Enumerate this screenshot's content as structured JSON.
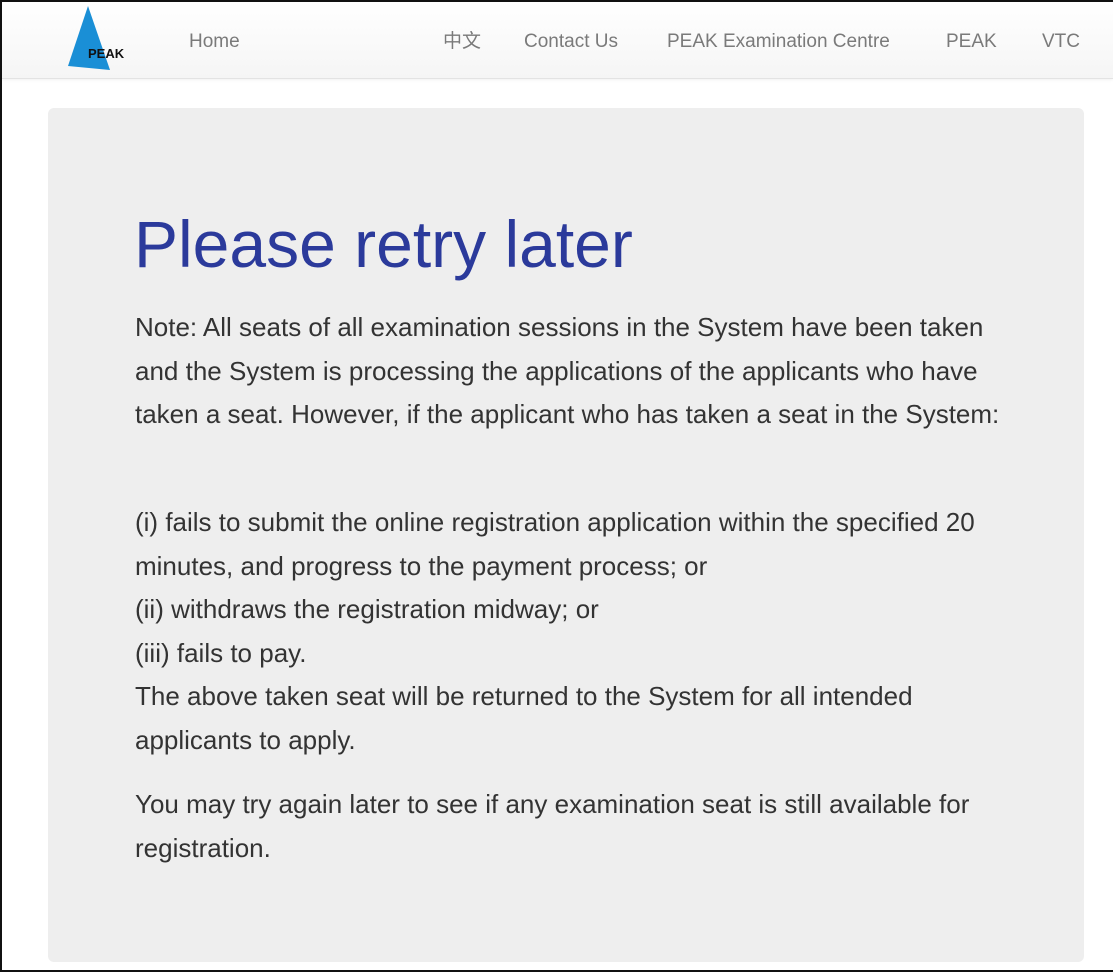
{
  "brand": {
    "logo_text": "PEAK",
    "logo_color": "#1a8fd6"
  },
  "nav": {
    "home": "Home",
    "chinese": "中文",
    "contact": "Contact Us",
    "exam_centre": "PEAK Examination Centre",
    "peak": "PEAK",
    "vtc": "VTC"
  },
  "main": {
    "title": "Please retry later",
    "note": "Note: All seats of all examination sessions in the System have been taken and the System is processing the applications of the applicants who have taken a seat. However, if the applicant who has taken a seat in the System:",
    "conditions": [
      "(i) fails to submit the online registration application within the specified 20 minutes, and progress to the payment process; or",
      "(ii) withdraws the registration midway; or",
      "(iii) fails to pay.",
      "The above taken seat will be returned to the System for all intended applicants to apply."
    ],
    "closing": "You may try again later to see if any examination seat is still available for registration."
  },
  "colors": {
    "title": "#2b3a9b",
    "panel": "#eeeeee",
    "nav_text": "#7a7a7a"
  }
}
